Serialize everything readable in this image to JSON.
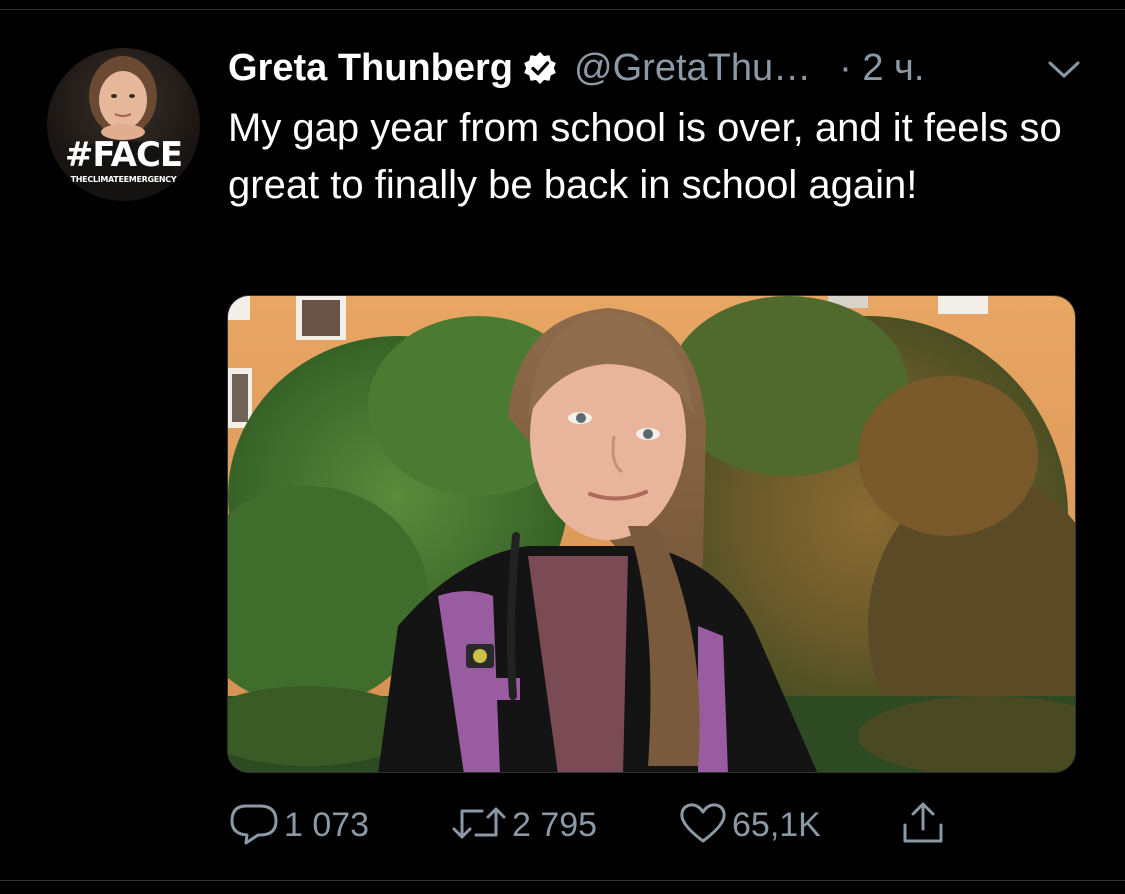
{
  "tweet": {
    "author": {
      "display_name": "Greta Thunberg",
      "handle": "@GretaThu…",
      "verified": true,
      "avatar": {
        "hashtag": "#FACE",
        "subtext": "THECLIMATEEMERGENCY"
      }
    },
    "time": "· 2 ч.",
    "text": "My gap year from school is over, and it feels so great to finally be back in school again!",
    "media": {
      "type": "photo"
    },
    "actions": {
      "reply": {
        "icon": "reply-icon",
        "count": "1 073"
      },
      "retweet": {
        "icon": "retweet-icon",
        "count": "2 795"
      },
      "like": {
        "icon": "heart-icon",
        "count": "65,1K"
      },
      "share": {
        "icon": "share-icon"
      }
    }
  },
  "colors": {
    "background": "#000000",
    "primary_text": "#ffffff",
    "secondary_text": "#8b98a5",
    "divider": "#2f3336",
    "verified_badge": "#ffffff"
  }
}
